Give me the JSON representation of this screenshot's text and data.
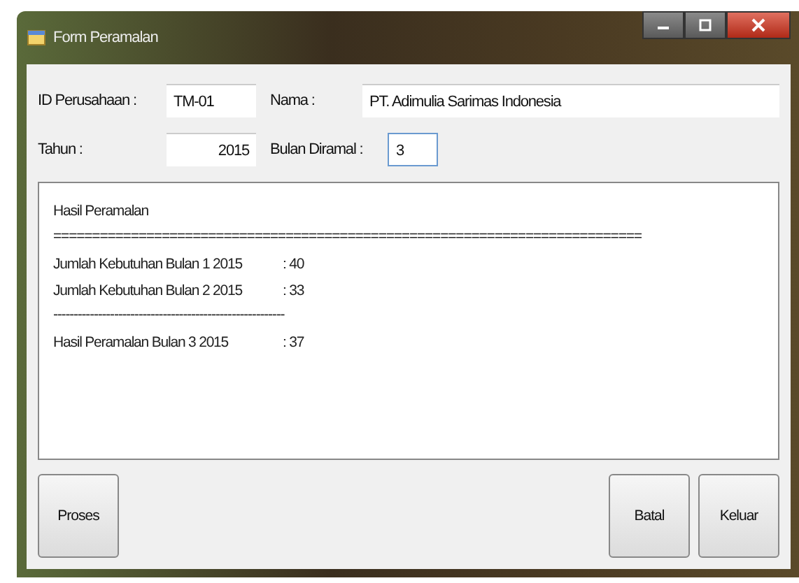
{
  "window": {
    "title": "Form Peramalan"
  },
  "fields": [
    {
      "label": "ID Perusahaan :",
      "value": "TM-01",
      "kind": "short"
    },
    {
      "label": "Nama :",
      "value": "PT. Adimulia Sarimas Indonesia",
      "kind": "wide"
    },
    {
      "label": "Tahun :",
      "value": "2015",
      "kind": "right"
    },
    {
      "label": "Bulan Diramal :",
      "value": "3",
      "kind": "focused"
    }
  ],
  "output": {
    "lines": [
      {
        "kind": "heading",
        "text": "Hasil Peramalan"
      },
      {
        "kind": "rule",
        "text": "============================================================================"
      },
      {
        "kind": "entry",
        "text": "Jumlah Kebutuhan Bulan 1 2015",
        "value": ": 40"
      },
      {
        "kind": "entry",
        "text": "Jumlah Kebutuhan Bulan 2 2015",
        "value": ": 33"
      },
      {
        "kind": "rule",
        "text": "---------------------------------------------------------"
      },
      {
        "kind": "entry",
        "text": "Hasil Peramalan Bulan 3 2015",
        "value": ": 37"
      }
    ]
  },
  "buttons": {
    "left": [
      "Proses"
    ],
    "right": [
      "Batal",
      "Keluar"
    ]
  }
}
